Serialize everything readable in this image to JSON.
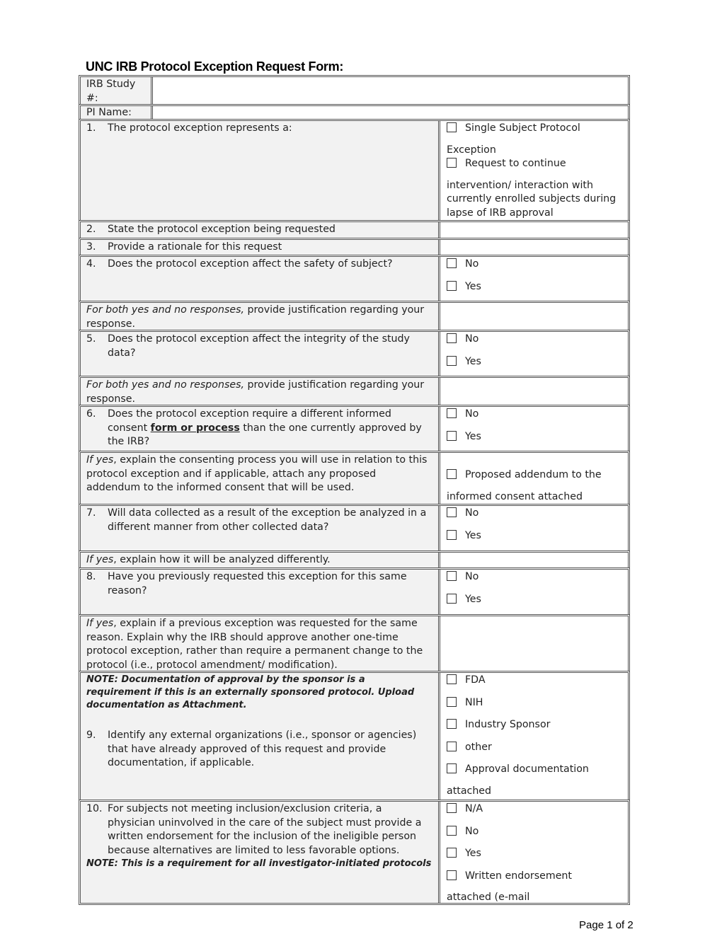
{
  "title": "UNC IRB Protocol Exception Request Form:",
  "header_fields": [
    {
      "label": "IRB Study #:",
      "value": ""
    },
    {
      "label": "PI Name:",
      "value": ""
    }
  ],
  "q1": {
    "num": "1.",
    "text": "The protocol exception represents a:",
    "options": [
      {
        "label": "Single Subject Protocol",
        "cont": "Exception",
        "checked": false
      },
      {
        "label": "Request to continue",
        "cont": "intervention/ interaction with currently enrolled subjects during lapse of IRB approval",
        "checked": false
      }
    ]
  },
  "q2": {
    "num": "2.",
    "text": "State the protocol exception being requested",
    "answer": ""
  },
  "q3": {
    "num": "3.",
    "text": "Provide a rationale for this request",
    "answer": ""
  },
  "q4": {
    "num": "4.",
    "text": "Does the protocol exception affect the safety of subject?",
    "options": [
      {
        "label": "No",
        "checked": false
      },
      {
        "label": "Yes",
        "checked": false
      }
    ]
  },
  "q4_just": {
    "italic": "For both yes and no responses,",
    "text": " provide justification regarding your response.",
    "answer": ""
  },
  "q5": {
    "num": "5.",
    "text": "Does the protocol exception affect the integrity of the study data?",
    "options": [
      {
        "label": "No",
        "checked": false
      },
      {
        "label": "Yes",
        "checked": false
      }
    ]
  },
  "q5_just": {
    "italic": "For both yes and no responses,",
    "text": " provide justification regarding your response.",
    "answer": ""
  },
  "q6": {
    "num": "6.",
    "text_a": "Does the protocol exception require a different informed consent ",
    "text_bold": "form or process",
    "text_b": " than the one currently approved by the IRB?",
    "options": [
      {
        "label": "No",
        "checked": false
      },
      {
        "label": "Yes",
        "checked": false
      }
    ]
  },
  "q6_follow": {
    "italic": "If yes",
    "text": ", explain the consenting process you will use in relation to this protocol exception and if applicable, attach any proposed addendum to the informed consent that will be used.",
    "option": {
      "label": "Proposed addendum to the",
      "cont": "informed consent attached",
      "checked": false
    }
  },
  "q7": {
    "num": "7.",
    "text": "Will data collected as a result of the exception be analyzed in a different manner from other collected data?",
    "options": [
      {
        "label": "No",
        "checked": false
      },
      {
        "label": "Yes",
        "checked": false
      }
    ]
  },
  "q7_follow": {
    "italic": "If yes",
    "text": ", explain how it will be analyzed differently.",
    "answer": ""
  },
  "q8": {
    "num": "8.",
    "text": "Have you previously requested this exception for this same reason?",
    "options": [
      {
        "label": "No",
        "checked": false
      },
      {
        "label": "Yes",
        "checked": false
      }
    ]
  },
  "q8_follow": {
    "italic": "If yes",
    "text": ", explain if a previous exception was requested for the same reason. Explain why the IRB should approve another one-time protocol exception, rather than require a permanent change to the protocol (i.e., protocol amendment/ modification).",
    "answer": ""
  },
  "q9": {
    "note": "NOTE: Documentation of approval by the sponsor is a requirement if this is an externally sponsored protocol.  Upload documentation as Attachment.",
    "num": "9.",
    "text": "Identify any external organizations (i.e., sponsor or agencies) that have already approved of this request and provide documentation, if applicable.",
    "options": [
      {
        "label": "FDA",
        "checked": false
      },
      {
        "label": "NIH",
        "checked": false
      },
      {
        "label": "Industry Sponsor",
        "checked": false
      },
      {
        "label": "other",
        "checked": false
      },
      {
        "label": "Approval documentation",
        "cont": "attached",
        "checked": false
      }
    ]
  },
  "q10": {
    "num": "10.",
    "text": "For subjects not meeting inclusion/exclusion criteria, a physician uninvolved in the care of the subject must provide a written endorsement for the inclusion of the ineligible person because alternatives are limited to less favorable options.",
    "note": "NOTE: This is a requirement for all investigator-initiated protocols",
    "options": [
      {
        "label": "N/A",
        "checked": false
      },
      {
        "label": "No",
        "checked": false
      },
      {
        "label": "Yes",
        "checked": false
      },
      {
        "label": "Written endorsement",
        "cont": "attached (e-mail",
        "checked": false
      }
    ]
  },
  "footer": "Page 1 of 2"
}
